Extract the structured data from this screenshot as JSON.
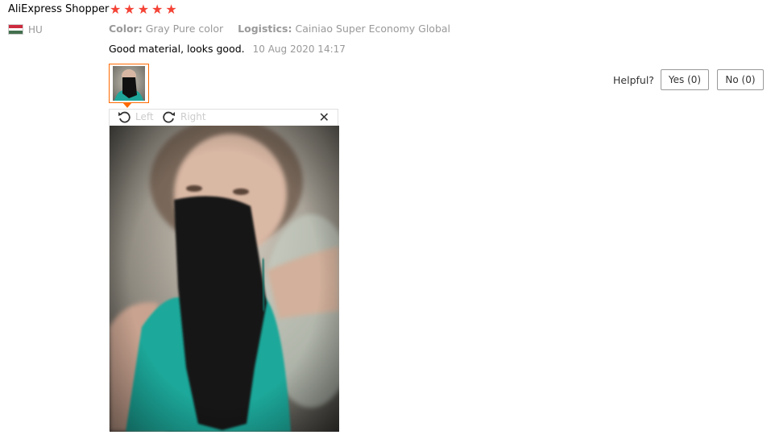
{
  "review": {
    "username": "AliExpress Shopper",
    "rating": 5,
    "country_code": "HU",
    "flag_colors": [
      "#cd2a3e",
      "#ffffff",
      "#436f4d"
    ],
    "attributes": {
      "color_label": "Color:",
      "color_value": "Gray Pure color",
      "logistics_label": "Logistics:",
      "logistics_value": "Cainiao Super Economy Global"
    },
    "comment": "Good material, looks good.",
    "date": "10 Aug 2020 14:17",
    "star_color": "#f44336",
    "accent_color": "#ff6a00"
  },
  "helpful": {
    "label": "Helpful?",
    "yes_label": "Yes (0)",
    "no_label": "No (0)"
  },
  "viewer": {
    "rotate_left_label": "Left",
    "rotate_right_label": "Right",
    "close_icon": "close-icon"
  }
}
